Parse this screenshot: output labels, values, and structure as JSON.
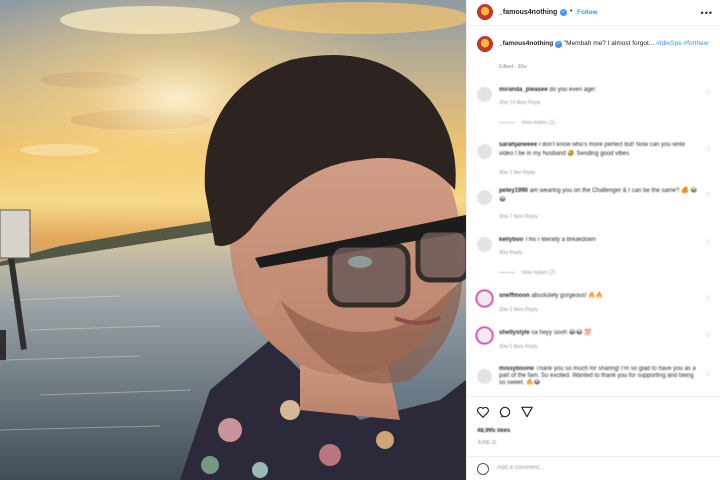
{
  "post": {
    "username": "_famous4nothing",
    "follow_label": "Follow",
    "more_label": "•••",
    "caption": {
      "username": "_famous4nothing",
      "text": "\"Membah me? I almost forgot...",
      "hashtags": "#IdleSpe #forthew",
      "meta": "Edited · 30w"
    },
    "comments": [
      {
        "username": "miranda_pleasee",
        "text": "do you even age!",
        "meta": "30w   14 likes   Reply",
        "replies": "View replies (1)"
      },
      {
        "username": "sarahjaneeee",
        "text": "I don't know who's more perfect but! Now can you write video I be in my husband 🤣 Sending good vibes",
        "meta": "30w   1 like   Reply",
        "replies": ""
      },
      {
        "username": "petey1990",
        "text": "am wearing you on the Challenger & I can be the same? 🍊 😂😂",
        "meta": "30w   7 likes   Reply",
        "replies": ""
      },
      {
        "username": "kellyboo",
        "text": "This I literally a breakdown",
        "meta": "30w   Reply",
        "replies": "View replies (2)"
      },
      {
        "username": "sneffmoon",
        "text": "absolutely gorgeous! 🔥🔥",
        "meta": "30w   2 likes   Reply",
        "replies": ""
      },
      {
        "username": "shellystyle",
        "text": "sa heyy oooh 😂😂 💯",
        "meta": "30w   5 likes   Reply",
        "replies": ""
      },
      {
        "username": "missyboone",
        "text": "Thank you so much for sharing! I'm so glad to have you as a part of the fam. So excited. Wanted to thank you for supporting and being so sweet. 🔥😂",
        "meta": "30w   3 likes   Reply",
        "replies": ""
      }
    ],
    "likes": "48,995 likes",
    "date": "JUNE 11",
    "add_comment_placeholder": "Add a comment..."
  },
  "colors": {
    "link_blue": "#3897f0",
    "text": "#262626",
    "muted": "#8e8e8e",
    "story_ring": "#d6249f"
  },
  "icons": [
    "heart-icon",
    "comment-icon",
    "share-icon",
    "verified-badge-icon",
    "emoji-icon",
    "more-options-icon"
  ]
}
